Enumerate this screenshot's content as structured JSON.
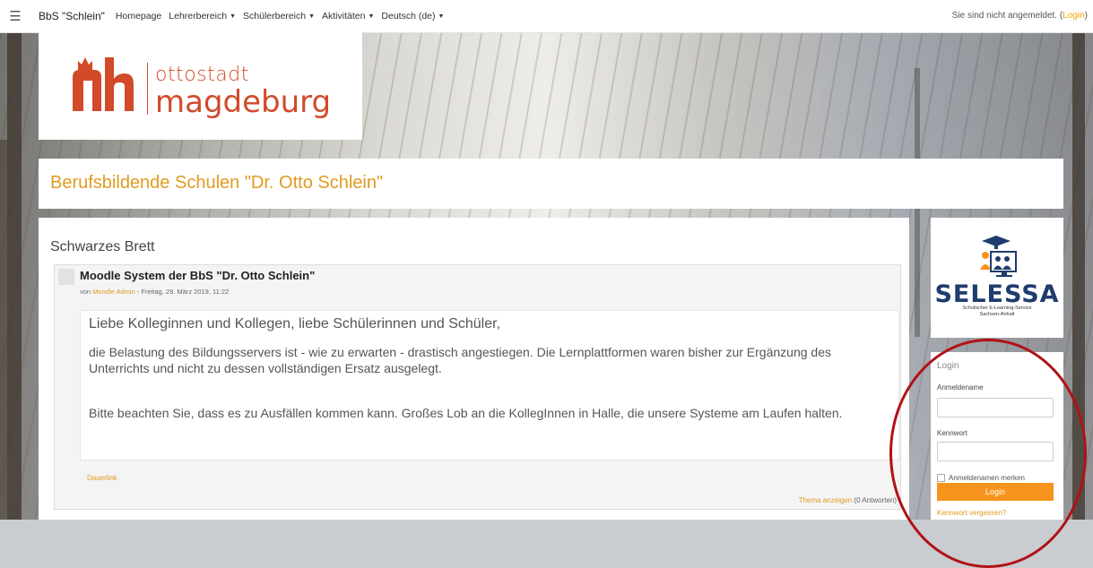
{
  "navbar": {
    "brand": "BbS \"Schlein\"",
    "items": [
      {
        "label": "Homepage"
      },
      {
        "label": "Lehrerbereich"
      },
      {
        "label": "Schülerbereich"
      },
      {
        "label": "Aktivitäten"
      },
      {
        "label": "Deutsch (de)"
      }
    ],
    "status_text": "Sie sind nicht angemeldet. (",
    "login_link": "Login",
    "status_close": ")"
  },
  "logo": {
    "line1": "ottostadt",
    "line2": "magdeburg"
  },
  "page_title": "Berufsbildende Schulen \"Dr. Otto Schlein\"",
  "news": {
    "heading": "Schwarzes Brett",
    "post": {
      "title": "Moodle System der BbS \"Dr. Otto Schlein\"",
      "by_prefix": "von ",
      "author": "Moodle Admin",
      "date": " - Freitag, 29. März 2019, 11:22",
      "greeting": "Liebe Kolleginnen und Kollegen, liebe Schülerinnen und Schüler,",
      "paragraph1": "die Belastung des Bildungsservers ist - wie zu erwarten - drastisch angestiegen. Die Lernplattformen waren bisher zur Ergänzung des Unterrichts und nicht zu dessen vollständigen Ersatz ausgelegt.",
      "paragraph2": "Bitte beachten Sie, dass es zu Ausfällen kommen kann. Großes Lob an die KollegInnen in Halle, die unsere Systeme am Laufen halten.",
      "permalink": "Dauerlink",
      "show_thread": "Thema anzeigen",
      "replies": " (0 Antworten)"
    }
  },
  "selessa": {
    "name": "SELESSA",
    "subtitle1": "Schulischer E-Learning-Service",
    "subtitle2": "Sachsen-Anhalt"
  },
  "login": {
    "title": "Login",
    "username_label": "Anmeldename",
    "username_value": "",
    "password_label": "Kennwort",
    "password_value": "",
    "remember_label": "Anmeldenamen merken",
    "button": "Login",
    "forgot": "Kennwort vergessen?"
  },
  "colors": {
    "accent": "#e09b20",
    "button": "#f7941d",
    "logo": "#d24a2a",
    "annotation": "#b01217"
  }
}
